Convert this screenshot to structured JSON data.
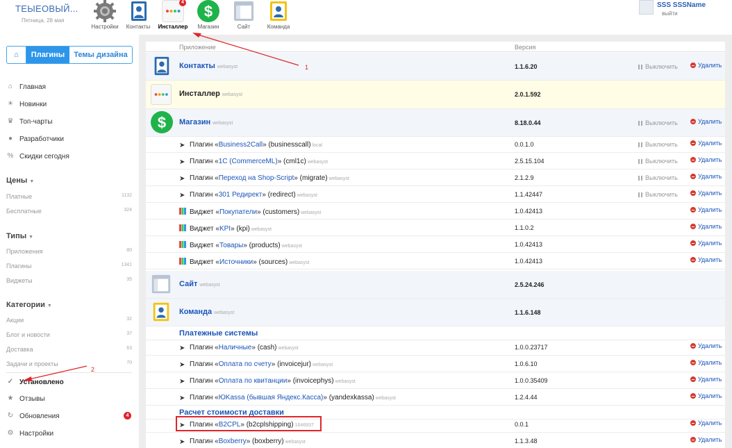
{
  "brand": {
    "title": "ТЕЫЕОВЫЙ...",
    "date": "Пятница, 28 мая"
  },
  "apps": [
    {
      "label": "Настройки",
      "icon": "gear-icon",
      "badge": ""
    },
    {
      "label": "Контакты",
      "icon": "contacts-icon",
      "badge": ""
    },
    {
      "label": "Инсталлер",
      "icon": "installer-icon",
      "badge": "4",
      "active": true
    },
    {
      "label": "Магазин",
      "icon": "shop-icon",
      "badge": ""
    },
    {
      "label": "Сайт",
      "icon": "site-icon",
      "badge": ""
    },
    {
      "label": "Команда",
      "icon": "team-icon",
      "badge": ""
    }
  ],
  "user": {
    "name": "SSS SSSName",
    "logout": "выйти"
  },
  "sidebar": {
    "tabs": {
      "plugins": "Плагины",
      "themes": "Темы дизайна"
    },
    "nav": [
      {
        "label": "Главная",
        "icon": "home-icon"
      },
      {
        "label": "Новинки",
        "icon": "sun-icon"
      },
      {
        "label": "Топ-чарты",
        "icon": "crown-icon"
      },
      {
        "label": "Разработчики",
        "icon": "users-icon"
      },
      {
        "label": "Скидки сегодня",
        "icon": "percent-icon"
      }
    ],
    "prices": {
      "title": "Цены",
      "items": [
        {
          "label": "Платные",
          "count": "1132"
        },
        {
          "label": "Бесплатные",
          "count": "324"
        }
      ]
    },
    "types": {
      "title": "Типы",
      "items": [
        {
          "label": "Приложения",
          "count": "80"
        },
        {
          "label": "Плагины",
          "count": "1341"
        },
        {
          "label": "Виджеты",
          "count": "35"
        }
      ]
    },
    "categories": {
      "title": "Категории",
      "items": [
        {
          "label": "Акции",
          "count": "32"
        },
        {
          "label": "Блог и новости",
          "count": "37"
        },
        {
          "label": "Доставка",
          "count": "63"
        },
        {
          "label": "Задачи и проекты",
          "count": "70"
        }
      ]
    },
    "bottom": [
      {
        "label": "Установлено",
        "icon": "check-icon",
        "badge": ""
      },
      {
        "label": "Отзывы",
        "icon": "star-icon",
        "badge": ""
      },
      {
        "label": "Обновления",
        "icon": "refresh-icon",
        "badge": "4"
      },
      {
        "label": "Настройки",
        "icon": "settings-icon",
        "badge": ""
      }
    ]
  },
  "table": {
    "col_app": "Приложение",
    "col_version": "Версия",
    "disable": "Выключить",
    "delete": "Удалить",
    "apps": {
      "contacts": {
        "name": "Контакты",
        "vendor": "webasyst",
        "version": "1.1.6.20"
      },
      "installer": {
        "name": "Инсталлер",
        "vendor": "webasyst",
        "version": "2.0.1.592"
      },
      "shop": {
        "name": "Магазин",
        "vendor": "webasyst",
        "version": "8.18.0.44"
      },
      "site": {
        "name": "Сайт",
        "vendor": "webasyst",
        "version": "2.5.24.246"
      },
      "team": {
        "name": "Команда",
        "vendor": "webasyst",
        "version": "1.1.6.148"
      }
    },
    "shop_items": [
      {
        "prefix": "Плагин «",
        "link": "Business2Call",
        "suffix": "» (businesscall)",
        "vendor": "local",
        "version": "0.0.1.0",
        "kind": "plugin",
        "disable": true
      },
      {
        "prefix": "Плагин «",
        "link": "1С (CommerceML)",
        "suffix": "» (cml1c)",
        "vendor": "webasyst",
        "version": "2.5.15.104",
        "kind": "plugin",
        "disable": true
      },
      {
        "prefix": "Плагин «",
        "link": "Переход на Shop-Script",
        "suffix": "» (migrate)",
        "vendor": "webasyst",
        "version": "2.1.2.9",
        "kind": "plugin",
        "disable": true
      },
      {
        "prefix": "Плагин «",
        "link": "301 Редирект",
        "suffix": "» (redirect)",
        "vendor": "webasyst",
        "version": "1.1.42447",
        "kind": "plugin",
        "disable": true
      },
      {
        "prefix": "Виджет «",
        "link": "Покупатели",
        "suffix": "» (customers)",
        "vendor": "webasyst",
        "version": "1.0.42413",
        "kind": "widget",
        "disable": false
      },
      {
        "prefix": "Виджет «",
        "link": "KPI",
        "suffix": "» (kpi)",
        "vendor": "webasyst",
        "version": "1.1.0.2",
        "kind": "widget",
        "disable": false
      },
      {
        "prefix": "Виджет «",
        "link": "Товары",
        "suffix": "» (products)",
        "vendor": "webasyst",
        "version": "1.0.42413",
        "kind": "widget",
        "disable": false
      },
      {
        "prefix": "Виджет «",
        "link": "Источники",
        "suffix": "» (sources)",
        "vendor": "webasyst",
        "version": "1.0.42413",
        "kind": "widget",
        "disable": false
      }
    ],
    "payment_title": "Платежные системы",
    "payment_items": [
      {
        "prefix": "Плагин «",
        "link": "Наличные",
        "suffix": "» (cash)",
        "vendor": "webasyst",
        "version": "1.0.0.23717"
      },
      {
        "prefix": "Плагин «",
        "link": "Оплата по счету",
        "suffix": "» (invoicejur)",
        "vendor": "webasyst",
        "version": "1.0.6.10"
      },
      {
        "prefix": "Плагин «",
        "link": "Оплата по квитанции",
        "suffix": "» (invoicephys)",
        "vendor": "webasyst",
        "version": "1.0.0.35409"
      },
      {
        "prefix": "Плагин «",
        "link": "ЮKassa (бывшая Яндекс.Касса)",
        "suffix": "» (yandexkassa)",
        "vendor": "webasyst",
        "version": "1.2.4.44"
      }
    ],
    "shipping_title": "Расчет стоимости доставки",
    "shipping_items": [
      {
        "prefix": "Плагин «",
        "link": "B2CPL",
        "suffix": "» (b2cplshipping)",
        "vendor": "1646937",
        "version": "0.0.1"
      },
      {
        "prefix": "Плагин «",
        "link": "Boxberry",
        "suffix": "» (boxberry)",
        "vendor": "webasyst",
        "version": "1.1.3.48"
      }
    ]
  },
  "annotations": {
    "one": "1",
    "two": "2",
    "color": "#e0242a"
  }
}
